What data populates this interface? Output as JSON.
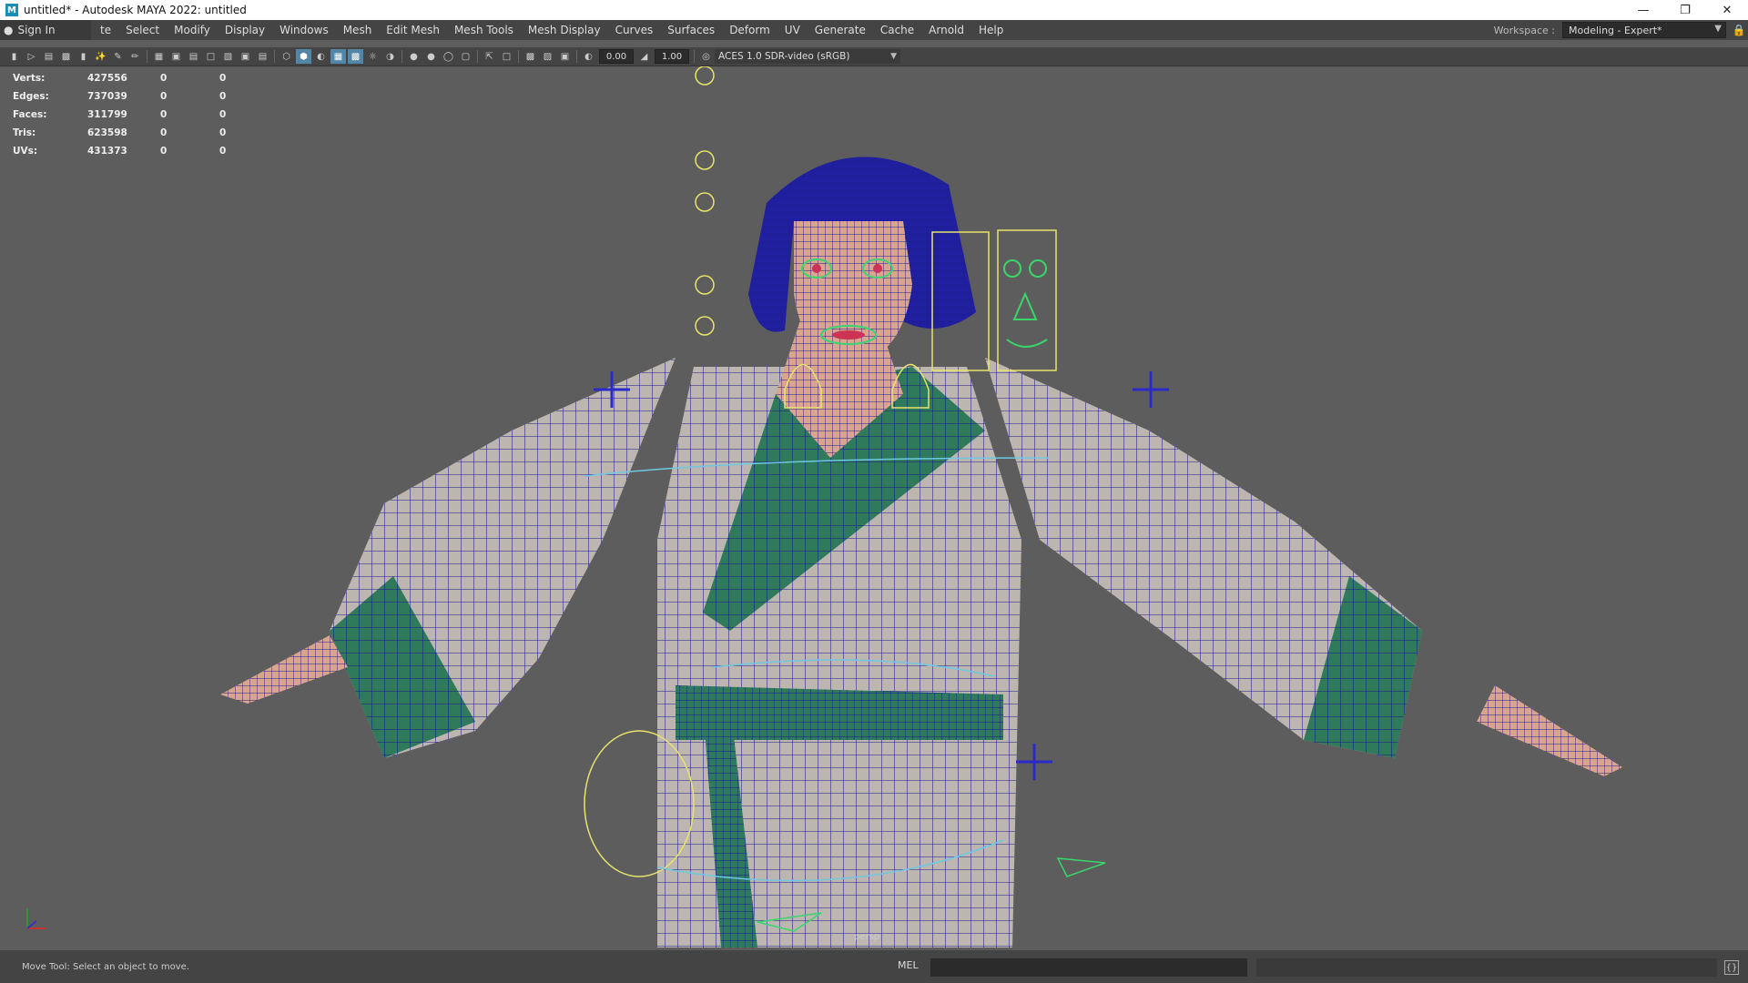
{
  "window": {
    "title": "untitled* - Autodesk MAYA 2022: untitled",
    "app_icon": "M",
    "minimize_icon": "minimize-icon",
    "maximize_icon": "restore-icon",
    "close_icon": "close-icon"
  },
  "menubar": {
    "sign_in": "Sign In",
    "items": [
      "te",
      "Select",
      "Modify",
      "Display",
      "Windows",
      "Mesh",
      "Edit Mesh",
      "Mesh Tools",
      "Mesh Display",
      "Curves",
      "Surfaces",
      "Deform",
      "UV",
      "Generate",
      "Cache",
      "Arnold",
      "Help"
    ],
    "workspace_label": "Workspace :",
    "workspace_value": "Modeling - Expert*"
  },
  "panel_toolbar": {
    "exposure": "0.00",
    "gamma": "1.00",
    "color_space": "ACES 1.0 SDR-video (sRGB)"
  },
  "hud": {
    "rows": [
      {
        "label": "Verts:",
        "v1": "427556",
        "v2": "0",
        "v3": "0"
      },
      {
        "label": "Edges:",
        "v1": "737039",
        "v2": "0",
        "v3": "0"
      },
      {
        "label": "Faces:",
        "v1": "311799",
        "v2": "0",
        "v3": "0"
      },
      {
        "label": "Tris:",
        "v1": "623598",
        "v2": "0",
        "v3": "0"
      },
      {
        "label": "UVs:",
        "v1": "431373",
        "v2": "0",
        "v3": "0"
      }
    ]
  },
  "viewport": {
    "camera": "persp",
    "colors": {
      "background": "#5d5d5d",
      "wireframe": "#1b1b8a",
      "robe": "#bdb6b0",
      "trim": "#2e7a5a",
      "hair": "#1f1fa0",
      "skin": "#d9a58c",
      "control_yellow": "#e8e36a",
      "control_cyan": "#6ec8e0",
      "locator_blue": "#2a2ac8"
    }
  },
  "statusbar": {
    "help_text": "Move Tool: Select an object to move.",
    "command_lang": "MEL"
  }
}
